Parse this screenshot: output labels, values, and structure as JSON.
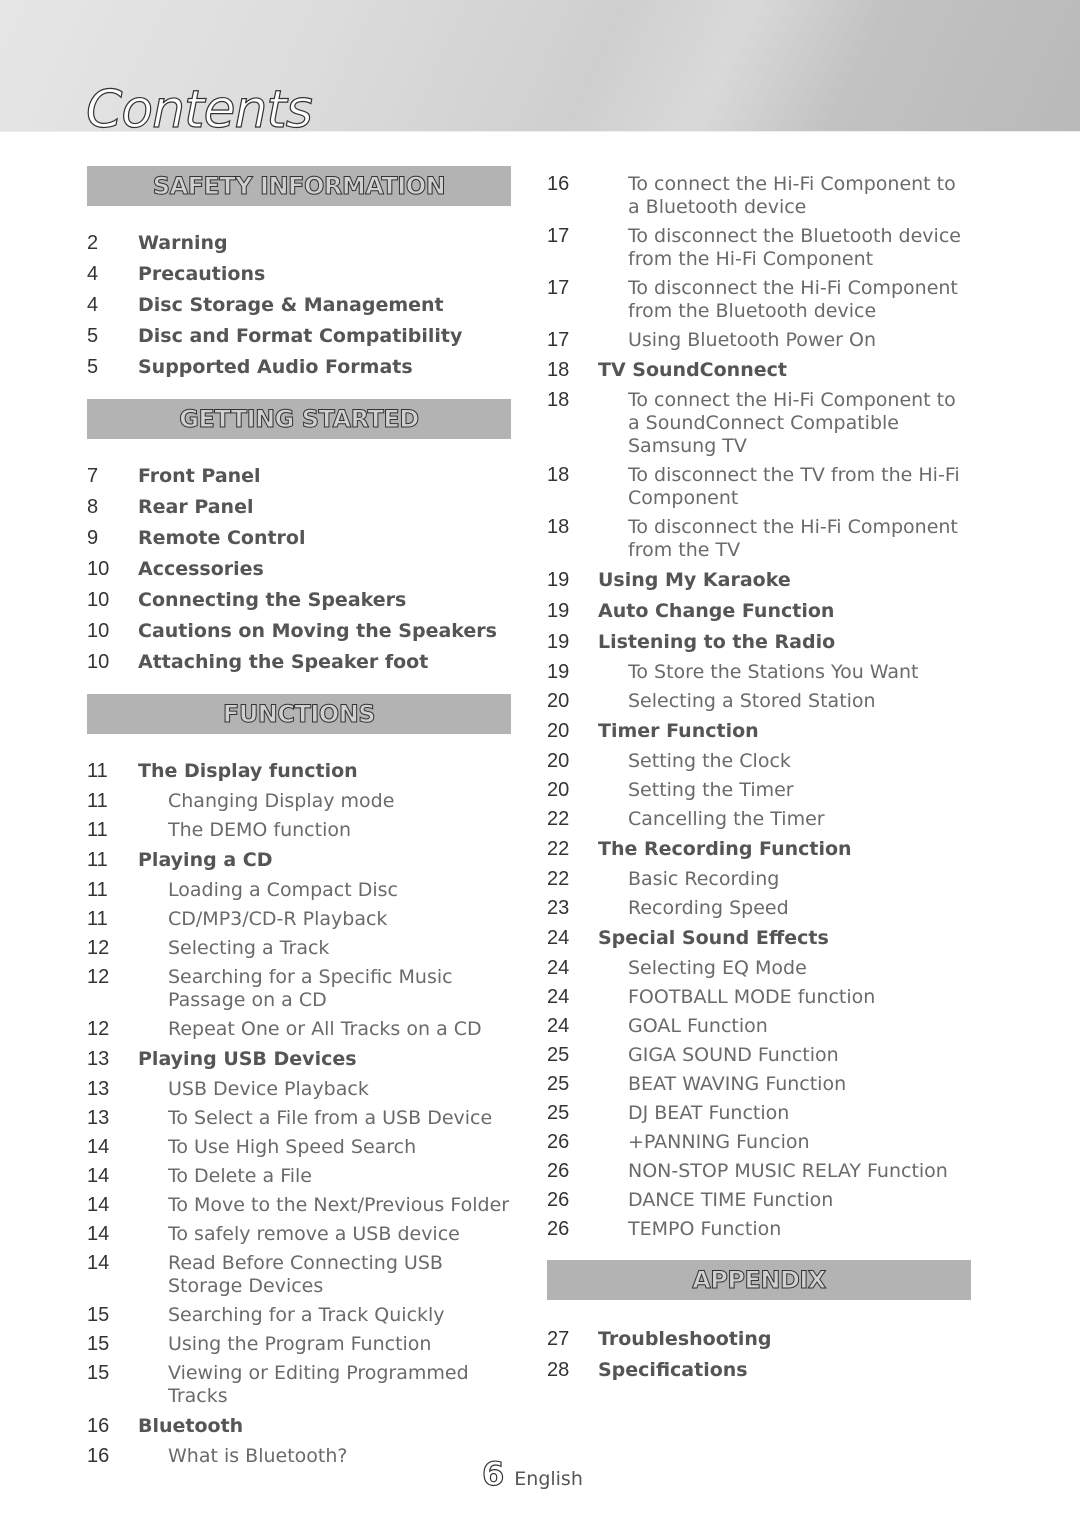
{
  "page": {
    "title": "Contents",
    "page_number": "6",
    "language": "English"
  },
  "left_column": [
    {
      "heading": "SAFETY INFORMATION",
      "entries": [
        {
          "page": "2",
          "label": "Warning",
          "level": 1
        },
        {
          "page": "4",
          "label": "Precautions",
          "level": 1
        },
        {
          "page": "4",
          "label": "Disc Storage & Management",
          "level": 1
        },
        {
          "page": "5",
          "label": "Disc and Format Compatibility",
          "level": 1
        },
        {
          "page": "5",
          "label": "Supported Audio Formats",
          "level": 1
        }
      ]
    },
    {
      "heading": "GETTING STARTED",
      "entries": [
        {
          "page": "7",
          "label": "Front Panel",
          "level": 1
        },
        {
          "page": "8",
          "label": "Rear Panel",
          "level": 1
        },
        {
          "page": "9",
          "label": "Remote Control",
          "level": 1
        },
        {
          "page": "10",
          "label": "Accessories",
          "level": 1
        },
        {
          "page": "10",
          "label": "Connecting the Speakers",
          "level": 1
        },
        {
          "page": "10",
          "label": "Cautions on Moving the Speakers",
          "level": 1
        },
        {
          "page": "10",
          "label": "Attaching the Speaker foot",
          "level": 1
        }
      ]
    },
    {
      "heading": "FUNCTIONS",
      "entries": [
        {
          "page": "11",
          "label": "The Display function",
          "level": 1
        },
        {
          "page": "11",
          "label": "Changing Display mode",
          "level": 2
        },
        {
          "page": "11",
          "label": "The DEMO function",
          "level": 2
        },
        {
          "page": "11",
          "label": "Playing a CD",
          "level": 1
        },
        {
          "page": "11",
          "label": "Loading a Compact Disc",
          "level": 2
        },
        {
          "page": "11",
          "label": "CD/MP3/CD-R Playback",
          "level": 2
        },
        {
          "page": "12",
          "label": "Selecting a Track",
          "level": 2
        },
        {
          "page": "12",
          "label": "Searching for a Specific Music Passage on a CD",
          "level": 2
        },
        {
          "page": "12",
          "label": "Repeat One or All Tracks on a CD",
          "level": 2
        },
        {
          "page": "13",
          "label": "Playing USB Devices",
          "level": 1
        },
        {
          "page": "13",
          "label": "USB Device Playback",
          "level": 2
        },
        {
          "page": "13",
          "label": "To Select a File from a USB Device",
          "level": 2
        },
        {
          "page": "14",
          "label": "To Use High Speed Search",
          "level": 2
        },
        {
          "page": "14",
          "label": "To Delete a File",
          "level": 2
        },
        {
          "page": "14",
          "label": "To Move to the Next/Previous Folder",
          "level": 2
        },
        {
          "page": "14",
          "label": "To safely remove a USB device",
          "level": 2
        },
        {
          "page": "14",
          "label": "Read Before Connecting USB Storage Devices",
          "level": 2
        },
        {
          "page": "15",
          "label": "Searching for a Track Quickly",
          "level": 2
        },
        {
          "page": "15",
          "label": "Using the Program Function",
          "level": 2
        },
        {
          "page": "15",
          "label": "Viewing or Editing Programmed Tracks",
          "level": 2
        },
        {
          "page": "16",
          "label": "Bluetooth",
          "level": 1
        },
        {
          "page": "16",
          "label": "What is Bluetooth?",
          "level": 2
        }
      ]
    }
  ],
  "right_column": [
    {
      "heading": null,
      "entries": [
        {
          "page": "16",
          "label": "To connect the Hi-Fi Component to a Bluetooth device",
          "level": 2
        },
        {
          "page": "17",
          "label": "To disconnect the Bluetooth device from the Hi-Fi Component",
          "level": 2
        },
        {
          "page": "17",
          "label": "To disconnect the Hi-Fi Component from the Bluetooth device",
          "level": 2
        },
        {
          "page": "17",
          "label": "Using Bluetooth Power On",
          "level": 2
        },
        {
          "page": "18",
          "label": "TV SoundConnect",
          "level": 1
        },
        {
          "page": "18",
          "label": "To connect the Hi-Fi Component to a SoundConnect Compatible Samsung TV",
          "level": 2
        },
        {
          "page": "18",
          "label": "To disconnect the TV from the Hi-Fi Component",
          "level": 2
        },
        {
          "page": "18",
          "label": "To disconnect the Hi-Fi Component from the TV",
          "level": 2
        },
        {
          "page": "19",
          "label": "Using My Karaoke",
          "level": 1
        },
        {
          "page": "19",
          "label": "Auto Change Function",
          "level": 1
        },
        {
          "page": "19",
          "label": "Listening to the Radio",
          "level": 1
        },
        {
          "page": "19",
          "label": "To Store the Stations You Want",
          "level": 2
        },
        {
          "page": "20",
          "label": "Selecting a Stored Station",
          "level": 2
        },
        {
          "page": "20",
          "label": "Timer Function",
          "level": 1
        },
        {
          "page": "20",
          "label": "Setting the Clock",
          "level": 2
        },
        {
          "page": "20",
          "label": "Setting the Timer",
          "level": 2
        },
        {
          "page": "22",
          "label": "Cancelling the Timer",
          "level": 2
        },
        {
          "page": "22",
          "label": "The Recording Function",
          "level": 1
        },
        {
          "page": "22",
          "label": "Basic Recording",
          "level": 2
        },
        {
          "page": "23",
          "label": "Recording Speed",
          "level": 2
        },
        {
          "page": "24",
          "label": "Special Sound Effects",
          "level": 1
        },
        {
          "page": "24",
          "label": "Selecting EQ Mode",
          "level": 2
        },
        {
          "page": "24",
          "label": "FOOTBALL MODE function",
          "level": 2
        },
        {
          "page": "24",
          "label": "GOAL Function",
          "level": 2
        },
        {
          "page": "25",
          "label": "GIGA SOUND Function",
          "level": 2
        },
        {
          "page": "25",
          "label": "BEAT WAVING Function",
          "level": 2
        },
        {
          "page": "25",
          "label": "DJ BEAT Function",
          "level": 2
        },
        {
          "page": "26",
          "label": "+PANNING Funcion",
          "level": 2
        },
        {
          "page": "26",
          "label": "NON-STOP MUSIC RELAY Function",
          "level": 2
        },
        {
          "page": "26",
          "label": "DANCE TIME Function",
          "level": 2
        },
        {
          "page": "26",
          "label": "TEMPO Function",
          "level": 2
        }
      ]
    },
    {
      "heading": "APPENDIX",
      "entries": [
        {
          "page": "27",
          "label": "Troubleshooting",
          "level": 1
        },
        {
          "page": "28",
          "label": "Specifications",
          "level": 1
        }
      ]
    }
  ],
  "colors": {
    "section_band": "#b3b3b3",
    "text": "#555555",
    "page_number_text": "#333333"
  }
}
